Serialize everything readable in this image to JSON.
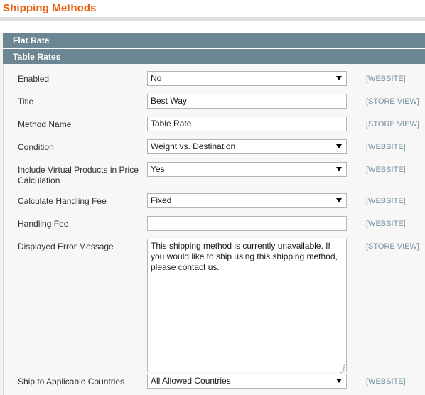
{
  "page": {
    "title": "Shipping Methods"
  },
  "sections": [
    {
      "label": "Flat Rate"
    },
    {
      "label": "Table Rates"
    }
  ],
  "form": {
    "rows": [
      {
        "label": "Enabled",
        "type": "select",
        "value": "No",
        "scope": "[WEBSITE]"
      },
      {
        "label": "Title",
        "type": "text",
        "value": "Best Way",
        "scope": "[STORE VIEW]"
      },
      {
        "label": "Method Name",
        "type": "text",
        "value": "Table Rate",
        "scope": "[STORE VIEW]"
      },
      {
        "label": "Condition",
        "type": "select",
        "value": "Weight vs. Destination",
        "scope": "[WEBSITE]"
      },
      {
        "label": "Include Virtual Products in Price Calculation",
        "type": "select",
        "value": "Yes",
        "scope": "[WEBSITE]"
      },
      {
        "label": "Calculate Handling Fee",
        "type": "select",
        "value": "Fixed",
        "scope": "[WEBSITE]"
      },
      {
        "label": "Handling Fee",
        "type": "text",
        "value": "",
        "scope": "[WEBSITE]"
      },
      {
        "label": "Displayed Error Message",
        "type": "textarea",
        "value": "This shipping method is currently unavailable. If you would like to ship using this shipping method, please contact us.",
        "scope": "[STORE VIEW]"
      },
      {
        "label": "Ship to Applicable Countries",
        "type": "select",
        "value": "All Allowed Countries",
        "scope": "[WEBSITE]"
      }
    ]
  },
  "colors": {
    "title_orange": "#e8600f",
    "section_bar": "#6d8693",
    "scope_blue": "#7590a0",
    "form_bg": "#f7f7f7"
  }
}
